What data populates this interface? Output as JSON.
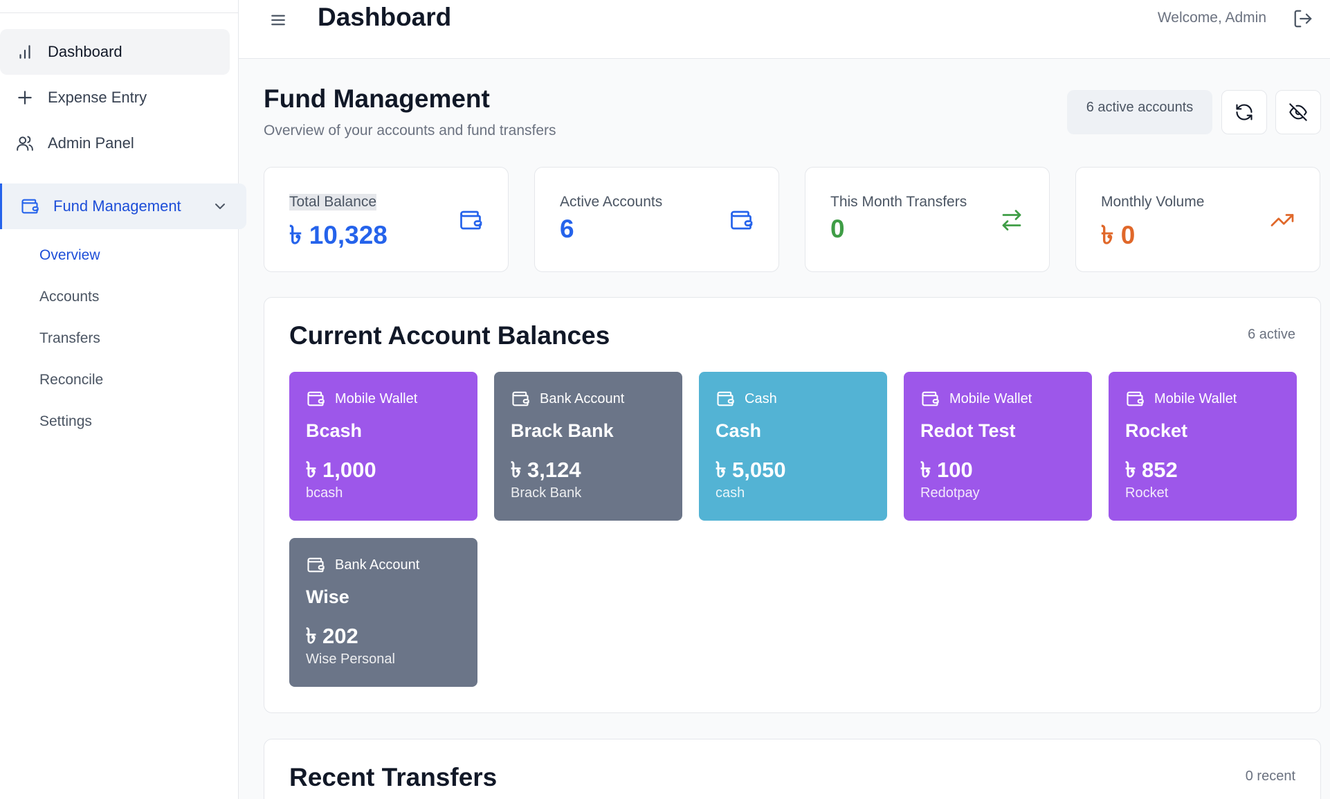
{
  "colors": {
    "primary": "#2563eb",
    "green": "#3f9d46",
    "orange": "#e0682a",
    "purple": "#9d57ea",
    "slate": "#6b7588",
    "teal": "#53b3d4"
  },
  "sidebar": {
    "items": [
      {
        "label": "Dashboard",
        "icon": "bar-chart-icon"
      },
      {
        "label": "Expense Entry",
        "icon": "plus-icon"
      },
      {
        "label": "Admin Panel",
        "icon": "users-icon"
      }
    ],
    "group": {
      "label": "Fund Management",
      "icon": "wallet-icon"
    },
    "sub_items": [
      {
        "label": "Overview",
        "active": true
      },
      {
        "label": "Accounts"
      },
      {
        "label": "Transfers"
      },
      {
        "label": "Reconcile"
      },
      {
        "label": "Settings"
      }
    ]
  },
  "header": {
    "title": "Dashboard",
    "welcome": "Welcome, Admin"
  },
  "main": {
    "title": "Fund Management",
    "subtitle": "Overview of your accounts and fund transfers",
    "active_badge": "6 active accounts",
    "stats": [
      {
        "label": "Total Balance",
        "value": "৳ 10,328",
        "icon": "wallet-icon"
      },
      {
        "label": "Active Accounts",
        "value": "6",
        "icon": "wallet-icon"
      },
      {
        "label": "This Month Transfers",
        "value": "0",
        "icon": "transfer-arrows-icon"
      },
      {
        "label": "Monthly Volume",
        "value": "৳ 0",
        "icon": "trending-up-icon"
      }
    ],
    "balances": {
      "title": "Current Account Balances",
      "count": "6 active",
      "accounts": [
        {
          "type": "Mobile Wallet",
          "name": "Bcash",
          "balance": "৳ 1,000",
          "sub": "bcash",
          "color": "purple"
        },
        {
          "type": "Bank Account",
          "name": "Brack Bank",
          "balance": "৳ 3,124",
          "sub": "Brack Bank",
          "color": "slate"
        },
        {
          "type": "Cash",
          "name": "Cash",
          "balance": "৳ 5,050",
          "sub": "cash",
          "color": "teal"
        },
        {
          "type": "Mobile Wallet",
          "name": "Redot Test",
          "balance": "৳ 100",
          "sub": "Redotpay",
          "color": "purple"
        },
        {
          "type": "Mobile Wallet",
          "name": "Rocket",
          "balance": "৳ 852",
          "sub": "Rocket",
          "color": "purple"
        },
        {
          "type": "Bank Account",
          "name": "Wise",
          "balance": "৳ 202",
          "sub": "Wise Personal",
          "color": "slate"
        }
      ]
    },
    "recent": {
      "title": "Recent Transfers",
      "count": "0 recent"
    }
  }
}
